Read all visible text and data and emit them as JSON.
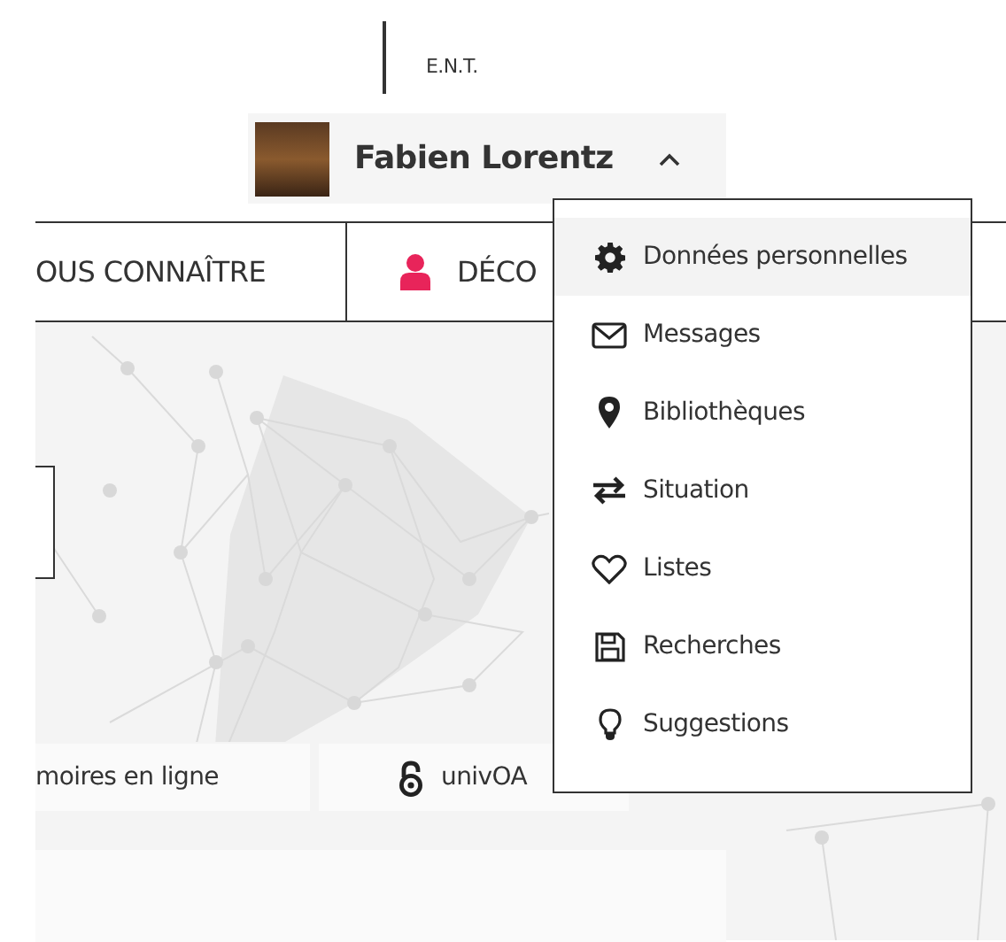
{
  "header": {
    "ent_link": "E.N.T."
  },
  "user_menu": {
    "name": "Fabien Lorentz",
    "expanded": true,
    "items": [
      {
        "kind": "gear",
        "label": "Données personnelles",
        "selected": true
      },
      {
        "kind": "envelope",
        "label": "Messages",
        "selected": false
      },
      {
        "kind": "pin",
        "label": "Bibliothèques",
        "selected": false
      },
      {
        "kind": "exchange",
        "label": "Situation",
        "selected": false
      },
      {
        "kind": "heart",
        "label": "Listes",
        "selected": false
      },
      {
        "kind": "floppy",
        "label": "Recherches",
        "selected": false
      },
      {
        "kind": "bulb",
        "label": "Suggestions",
        "selected": false
      }
    ]
  },
  "nav": [
    {
      "kind": "text",
      "label": "OUS CONNAÎTRE"
    },
    {
      "kind": "user",
      "label": "DÉCO"
    }
  ],
  "links": [
    {
      "kind": "text",
      "label": "moires en ligne"
    },
    {
      "kind": "open-access",
      "label": "univOA"
    }
  ]
}
